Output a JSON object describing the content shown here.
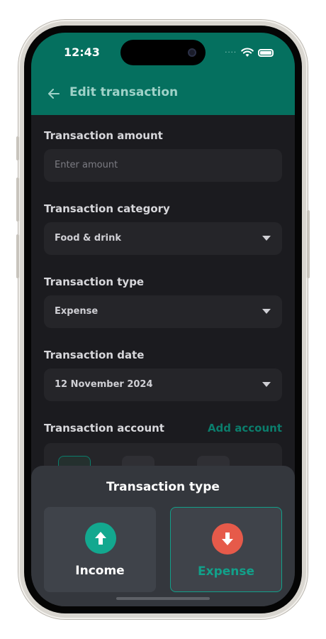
{
  "status": {
    "time": "12:43"
  },
  "header": {
    "title": "Edit transaction",
    "back_icon": "arrow-left-icon"
  },
  "form": {
    "amount": {
      "label": "Transaction amount",
      "placeholder": "Enter amount",
      "value": ""
    },
    "category": {
      "label": "Transaction category",
      "value": "Food & drink"
    },
    "type": {
      "label": "Transaction type",
      "value": "Expense"
    },
    "date": {
      "label": "Transaction date",
      "value": "12 November 2024"
    },
    "account": {
      "label": "Transaction account",
      "add_label": "Add account"
    }
  },
  "sheet": {
    "title": "Transaction type",
    "options": [
      {
        "label": "Income",
        "icon": "arrow-up-icon",
        "color": "#13a88f",
        "selected": false
      },
      {
        "label": "Expense",
        "icon": "arrow-down-icon",
        "color": "#e65a4a",
        "selected": true
      }
    ]
  },
  "colors": {
    "accent": "#05705f",
    "background": "#1b1b1f",
    "field": "#252529",
    "sheet": "#34373d",
    "income": "#13a88f",
    "expense": "#e65a4a",
    "expense_label": "#12a08a"
  }
}
